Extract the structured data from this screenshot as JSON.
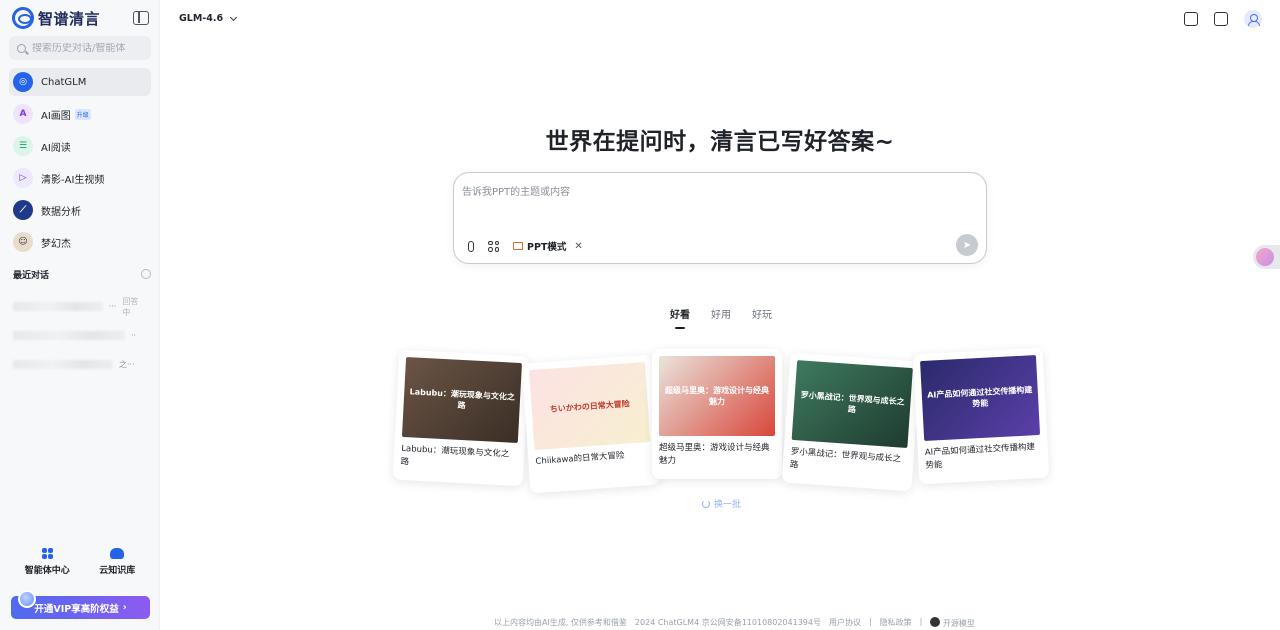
{
  "sidebar": {
    "logo_text": "智谱清言",
    "search_placeholder": "搜索历史对话/智能体",
    "nav": [
      {
        "label": "ChatGLM",
        "icon": "chatglm-logo-icon",
        "color": "#2563eb"
      },
      {
        "label": "AI画图",
        "icon": "ai-draw-icon",
        "color": "#e9d5ff",
        "badge": "升级"
      },
      {
        "label": "AI阅读",
        "icon": "ai-read-icon",
        "color": "#d1fae5"
      },
      {
        "label": "清影-AI生视频",
        "icon": "video-play-icon",
        "color": "#ede9fe"
      },
      {
        "label": "数据分析",
        "icon": "chart-icon",
        "color": "#1e3a8a"
      },
      {
        "label": "梦幻杰",
        "icon": "avatar-icon",
        "color": "#f3e8d8"
      }
    ],
    "recent_title": "最近对话",
    "recent": [
      {
        "suffix": "···",
        "status": "回答中"
      },
      {
        "suffix": "··",
        "status": ""
      },
      {
        "suffix": "之···",
        "status": ""
      }
    ],
    "tools": [
      {
        "label": "智能体中心",
        "icon": "agent-center-icon"
      },
      {
        "label": "云知识库",
        "icon": "cloud-knowledge-icon"
      }
    ],
    "vip_label": "开通VIP享高阶权益"
  },
  "topbar": {
    "model": "GLM-4.6"
  },
  "main": {
    "headline": "世界在提问时，清言已写好答案~",
    "input_placeholder": "告诉我PPT的主题或内容",
    "mode_chip": "PPT模式",
    "mode_chip_close": "✕",
    "send": "➤",
    "tabs": [
      "好看",
      "好用",
      "好玩"
    ],
    "cards": [
      {
        "title": "Labubu：潮玩现象与文化之路",
        "image_text": "Labubu：潮玩现象与文化之路",
        "color": "#5a4a3a"
      },
      {
        "title": "Chiikawa的日常大冒险",
        "image_text": "ちいかわの日常大冒险",
        "color": "#f6d4d7"
      },
      {
        "title": "超级马里奥：游戏设计与经典魅力",
        "image_text": "超级马里奥：游戏设计与经典魅力",
        "color": "#d9463a"
      },
      {
        "title": "罗小黑战记：世界观与成长之路",
        "image_text": "罗小黑战记：世界观与成长之路",
        "color": "#2f5f4a"
      },
      {
        "title": "AI产品如何通过社交传播构建势能",
        "image_text": "AI产品如何通过社交传播构建势能",
        "color": "#3b2f7a"
      }
    ],
    "refresh": "换一批"
  },
  "footer": {
    "disclaimer": "以上内容均由AI生成, 仅供参考和借鉴",
    "icp": "2024 ChatGLM4 京公网安备11010802041394号",
    "user_agreement": "用户协议",
    "privacy": "隐私政策",
    "open_source": "开源模型"
  }
}
